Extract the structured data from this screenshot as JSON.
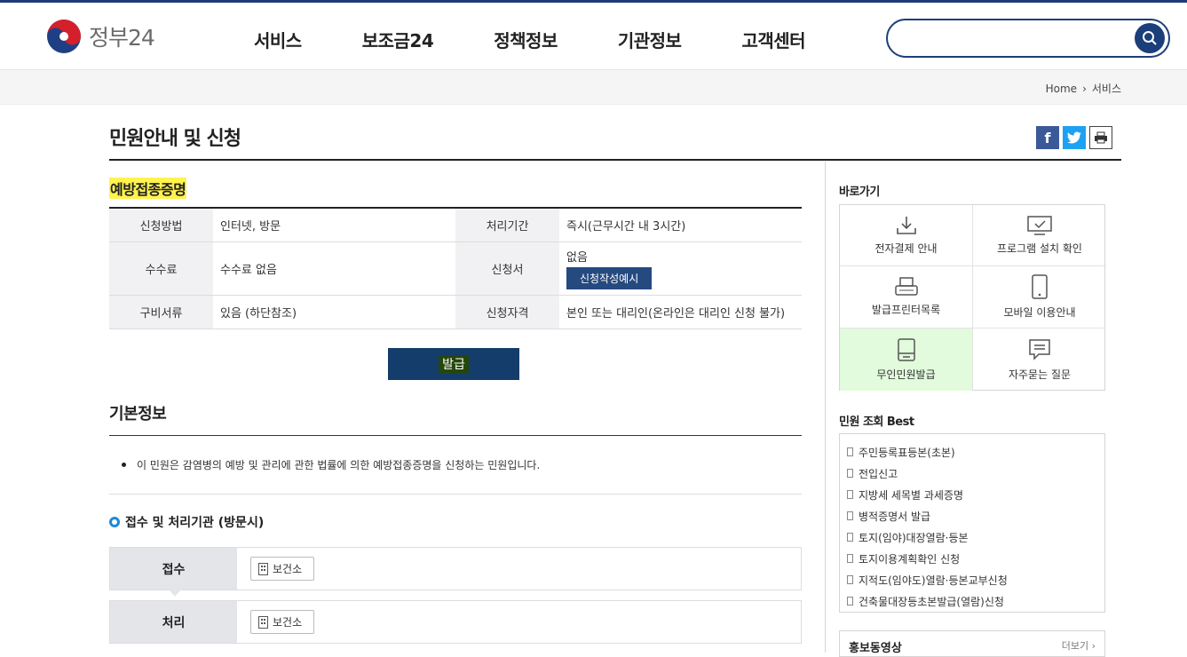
{
  "header": {
    "logo_text": "정부24",
    "nav": [
      "서비스",
      "보조금24",
      "정책정보",
      "기관정보",
      "고객센터"
    ],
    "search_placeholder": ""
  },
  "breadcrumb": {
    "home": "Home",
    "current": "서비스"
  },
  "page": {
    "title": "민원안내 및 신청",
    "service_name": "예방접종증명"
  },
  "info_table": {
    "apply_method_label": "신청방법",
    "apply_method": "인터넷, 방문",
    "period_label": "처리기간",
    "period": "즉시(근무시간 내 3시간)",
    "fee_label": "수수료",
    "fee": "수수료 없음",
    "form_label": "신청서",
    "form": "없음",
    "form_example_btn": "신청작성예시",
    "docs_label": "구비서류",
    "docs": "있음 (하단참조)",
    "eligibility_label": "신청자격",
    "eligibility": "본인 또는 대리인(온라인은 대리인 신청 불가)"
  },
  "issue_button": "발급",
  "basic_info": {
    "title": "기본정보",
    "description": "이 민원은 감염병의 예방 및 관리에 관한 법률에 의한 예방접종증명을 신청하는 민원입니다."
  },
  "process": {
    "title": "접수 및 처리기관 (방문시)",
    "receive_label": "접수",
    "receive_org": "보건소",
    "handle_label": "처리",
    "handle_org": "보건소"
  },
  "sidebar": {
    "quick_title": "바로가기",
    "quick_items": [
      "전자결제 안내",
      "프로그램 설치 확인",
      "발급프린터목록",
      "모바일 이용안내",
      "무인민원발급",
      "자주묻는 질문"
    ],
    "best_title": "민원 조회 Best",
    "best_items": [
      "주민등록표등본(초본)",
      "전입신고",
      "지방세 세목별 과세증명",
      "병적증명서 발급",
      "토지(임야)대장열람·등본",
      "토지이용계획확인 신청",
      "지적도(임야도)열람·등본교부신청",
      "건축물대장등초본발급(열람)신청"
    ],
    "promo_title": "홍보동영상",
    "promo_more": "더보기 ›"
  },
  "colors": {
    "navy": "#1b3f7a",
    "highlight": "#fff34d",
    "quick_highlight": "#e1fbdc"
  }
}
